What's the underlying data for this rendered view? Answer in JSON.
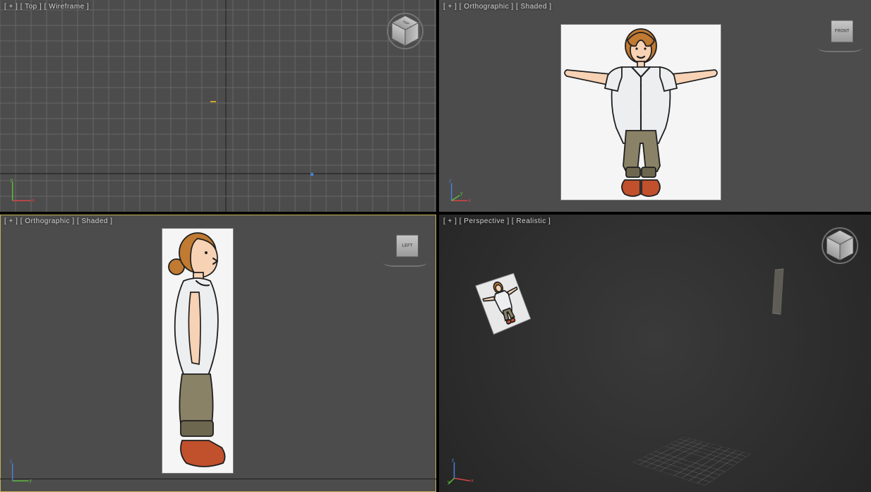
{
  "viewports": {
    "tl": {
      "maximize": "[ + ]",
      "view": "[ Top ]",
      "shading": "[ Wireframe ]",
      "cube_face": "TOP"
    },
    "tr": {
      "maximize": "[ + ]",
      "view": "[ Orthographic ]",
      "shading": "[ Shaded ]",
      "cube_face": "FRONT"
    },
    "bl": {
      "maximize": "[ + ]",
      "view": "[ Orthographic ]",
      "shading": "[ Shaded ]",
      "cube_face": "LEFT"
    },
    "br": {
      "maximize": "[ + ]",
      "view": "[ Perspective ]",
      "shading": "[ Realistic ]",
      "cube_face": ""
    }
  },
  "axes": {
    "x": "x",
    "y": "y",
    "z": "z"
  },
  "colors": {
    "axis_x": "#d64444",
    "axis_y": "#5cba3c",
    "axis_z": "#4b7ed6",
    "active_outline": "#c6b255",
    "viewport_bg": "#4c4c4c",
    "viewport_dark": "#303030"
  }
}
